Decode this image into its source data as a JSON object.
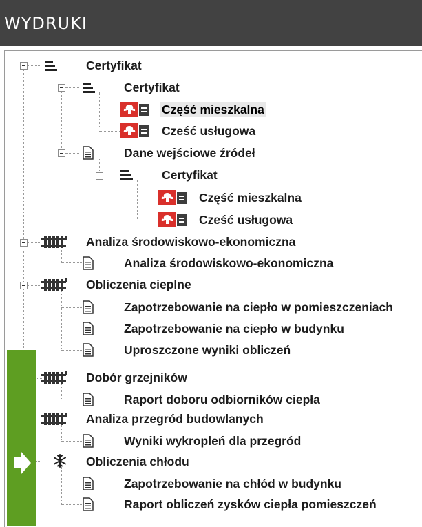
{
  "header": {
    "title": "WYDRUKI"
  },
  "tree": {
    "items": [
      {
        "label": "Certyfikat",
        "icon": "stack-icon"
      },
      {
        "label": "Certyfikat",
        "icon": "stack-icon"
      },
      {
        "label": "Część mieszkalna",
        "icon": "emblem-doc-icon",
        "selected": true
      },
      {
        "label": "Cześć usługowa",
        "icon": "emblem-doc-icon"
      },
      {
        "label": "Dane wejściowe źródeł",
        "icon": "document-icon"
      },
      {
        "label": "Certyfikat",
        "icon": "stack-icon"
      },
      {
        "label": "Część mieszkalna",
        "icon": "emblem-doc-icon"
      },
      {
        "label": "Cześć usługowa",
        "icon": "emblem-doc-icon"
      },
      {
        "label": "Analiza środowiskowo-ekonomiczna",
        "icon": "radiator-icon"
      },
      {
        "label": "Analiza środowiskowo-ekonomiczna",
        "icon": "document-icon"
      },
      {
        "label": "Obliczenia cieplne",
        "icon": "radiator-icon"
      },
      {
        "label": "Zapotrzebowanie na ciepło w pomieszczeniach",
        "icon": "document-icon"
      },
      {
        "label": "Zapotrzebowanie na ciepło w budynku",
        "icon": "document-icon"
      },
      {
        "label": "Uproszczone wyniki obliczeń",
        "icon": "document-icon"
      },
      {
        "label": "Dobór grzejników",
        "icon": "radiator-icon"
      },
      {
        "label": "Raport doboru odbiorników ciepła",
        "icon": "document-icon"
      },
      {
        "label": "Analiza przegród budowlanych",
        "icon": "radiator-icon"
      },
      {
        "label": "Wyniki wykropleń dla przegród",
        "icon": "document-icon"
      },
      {
        "label": "Obliczenia chłodu",
        "icon": "snowflake-icon"
      },
      {
        "label": "Zapotrzebowanie na chłód w budynku",
        "icon": "document-icon"
      },
      {
        "label": "Raport obliczeń zysków ciepła pomieszczeń",
        "icon": "document-icon"
      }
    ]
  },
  "colors": {
    "header_bg": "#424242",
    "header_text": "#ffffff",
    "accent_green": "#5e9e22",
    "emblem_red": "#d9302b",
    "text": "#1c1c1c"
  }
}
